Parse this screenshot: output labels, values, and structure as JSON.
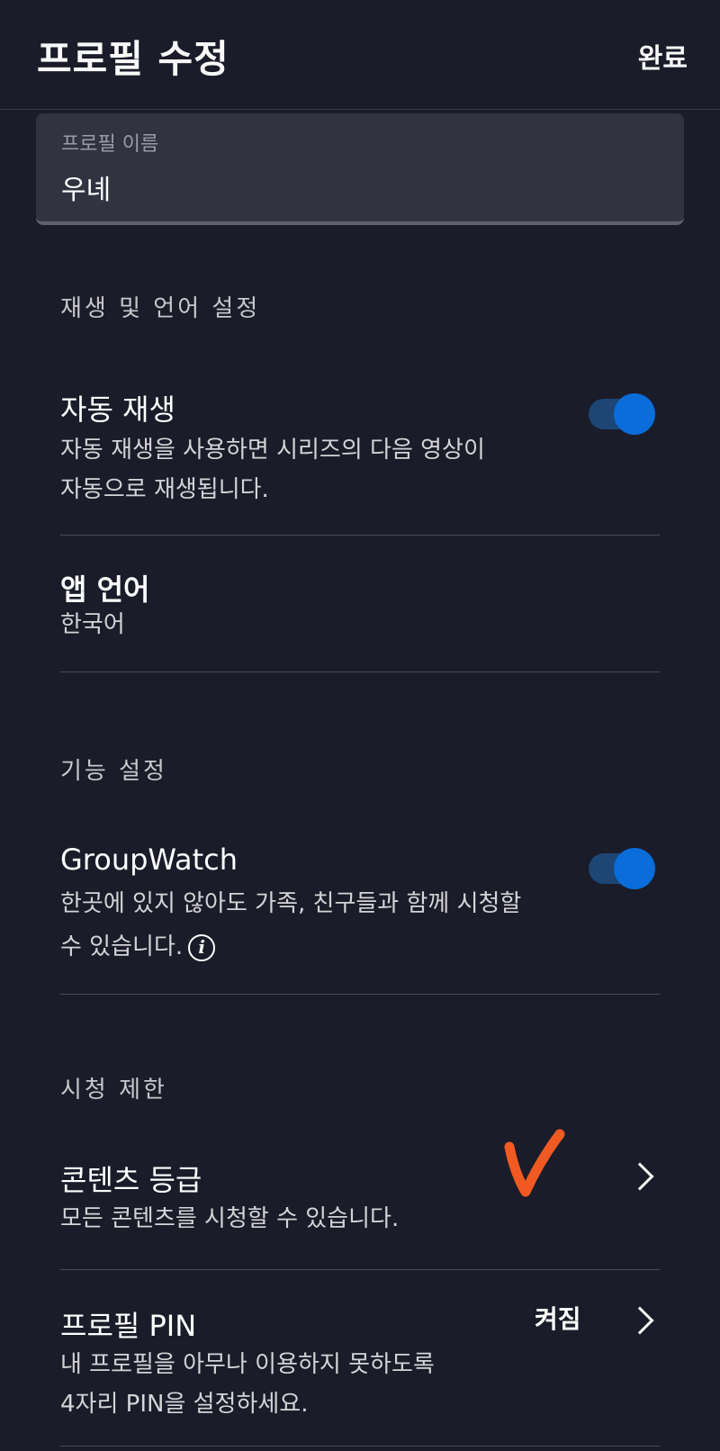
{
  "header": {
    "title": "프로필 수정",
    "done_label": "완료"
  },
  "profile_name": {
    "label": "프로필 이름",
    "value": "우녜"
  },
  "sections": {
    "playback": {
      "header": "재생 및 언어 설정",
      "autoplay": {
        "title": "자동 재생",
        "desc_line1": "자동 재생을 사용하면 시리즈의 다음 영상이",
        "desc_line2": "자동으로 재생됩니다.",
        "enabled": true
      },
      "app_language": {
        "title": "앱 언어",
        "value": "한국어"
      }
    },
    "features": {
      "header": "기능 설정",
      "groupwatch": {
        "title": "GroupWatch",
        "desc_line1": "한곳에 있지 않아도 가족, 친구들과 함께 시청할",
        "desc_line2": "수 있습니다.",
        "info_icon": "i",
        "enabled": true
      }
    },
    "restrictions": {
      "header": "시청 제한",
      "content_rating": {
        "title": "콘텐츠 등급",
        "desc": "모든 콘텐츠를 시청할 수 있습니다."
      },
      "profile_pin": {
        "title": "프로필 PIN",
        "status": "켜짐",
        "desc_line1": "내 프로필을 아무나 이용하지 못하도록",
        "desc_line2": "4자리 PIN을 설정하세요."
      }
    }
  },
  "colors": {
    "background": "#1b1c29",
    "toggle_on": "#0a6dd9",
    "annotation": "#f05a22"
  }
}
